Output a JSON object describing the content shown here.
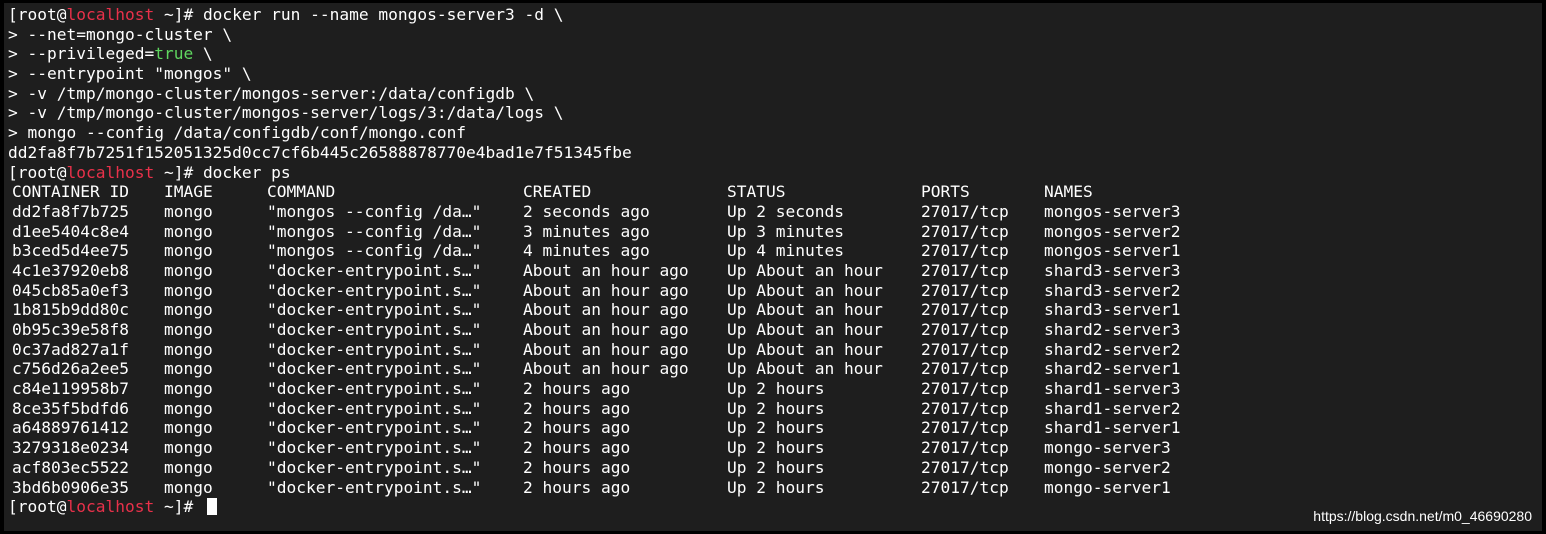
{
  "prompt": {
    "open": "[root@",
    "host": "localhost",
    "close": " ~]# "
  },
  "command_lines": [
    {
      "text": "docker run --name mongos-server3 -d \\"
    },
    {
      "prefix": "> ",
      "text": "--net=mongo-cluster \\"
    },
    {
      "prefix": "> ",
      "text": "--privileged=",
      "green": "true",
      "suffix": " \\"
    },
    {
      "prefix": "> ",
      "text": "--entrypoint \"mongos\" \\"
    },
    {
      "prefix": "> ",
      "text": "-v /tmp/mongo-cluster/mongos-server:/data/configdb \\"
    },
    {
      "prefix": "> ",
      "text": "-v /tmp/mongo-cluster/mongos-server/logs/3:/data/logs \\"
    },
    {
      "prefix": "> ",
      "text": "mongo --config /data/configdb/conf/mongo.conf"
    }
  ],
  "container_hash": "dd2fa8f7b7251f152051325d0cc7cf6b445c26588878770e4bad1e7f51345fbe",
  "ps_command": "docker ps",
  "table": {
    "headers": [
      "CONTAINER ID",
      "IMAGE",
      "COMMAND",
      "CREATED",
      "STATUS",
      "PORTS",
      "NAMES"
    ],
    "rows": [
      [
        "dd2fa8f7b725",
        "mongo",
        "\"mongos --config /da…\"",
        "2 seconds ago",
        "Up 2 seconds",
        "27017/tcp",
        "mongos-server3"
      ],
      [
        "d1ee5404c8e4",
        "mongo",
        "\"mongos --config /da…\"",
        "3 minutes ago",
        "Up 3 minutes",
        "27017/tcp",
        "mongos-server2"
      ],
      [
        "b3ced5d4ee75",
        "mongo",
        "\"mongos --config /da…\"",
        "4 minutes ago",
        "Up 4 minutes",
        "27017/tcp",
        "mongos-server1"
      ],
      [
        "4c1e37920eb8",
        "mongo",
        "\"docker-entrypoint.s…\"",
        "About an hour ago",
        "Up About an hour",
        "27017/tcp",
        "shard3-server3"
      ],
      [
        "045cb85a0ef3",
        "mongo",
        "\"docker-entrypoint.s…\"",
        "About an hour ago",
        "Up About an hour",
        "27017/tcp",
        "shard3-server2"
      ],
      [
        "1b815b9dd80c",
        "mongo",
        "\"docker-entrypoint.s…\"",
        "About an hour ago",
        "Up About an hour",
        "27017/tcp",
        "shard3-server1"
      ],
      [
        "0b95c39e58f8",
        "mongo",
        "\"docker-entrypoint.s…\"",
        "About an hour ago",
        "Up About an hour",
        "27017/tcp",
        "shard2-server3"
      ],
      [
        "0c37ad827a1f",
        "mongo",
        "\"docker-entrypoint.s…\"",
        "About an hour ago",
        "Up About an hour",
        "27017/tcp",
        "shard2-server2"
      ],
      [
        "c756d26a2ee5",
        "mongo",
        "\"docker-entrypoint.s…\"",
        "About an hour ago",
        "Up About an hour",
        "27017/tcp",
        "shard2-server1"
      ],
      [
        "c84e119958b7",
        "mongo",
        "\"docker-entrypoint.s…\"",
        "2 hours ago",
        "Up 2 hours",
        "27017/tcp",
        "shard1-server3"
      ],
      [
        "8ce35f5bdfd6",
        "mongo",
        "\"docker-entrypoint.s…\"",
        "2 hours ago",
        "Up 2 hours",
        "27017/tcp",
        "shard1-server2"
      ],
      [
        "a64889761412",
        "mongo",
        "\"docker-entrypoint.s…\"",
        "2 hours ago",
        "Up 2 hours",
        "27017/tcp",
        "shard1-server1"
      ],
      [
        "3279318e0234",
        "mongo",
        "\"docker-entrypoint.s…\"",
        "2 hours ago",
        "Up 2 hours",
        "27017/tcp",
        "mongo-server3"
      ],
      [
        "acf803ec5522",
        "mongo",
        "\"docker-entrypoint.s…\"",
        "2 hours ago",
        "Up 2 hours",
        "27017/tcp",
        "mongo-server2"
      ],
      [
        "3bd6b0906e35",
        "mongo",
        "\"docker-entrypoint.s…\"",
        "2 hours ago",
        "Up 2 hours",
        "27017/tcp",
        "mongo-server1"
      ]
    ]
  },
  "watermark": "https://blog.csdn.net/m0_46690280",
  "colors": {
    "background": "#1e1e1e",
    "hostname": "#e8314a",
    "boolean": "#5fd75f",
    "text": "#ffffff"
  }
}
